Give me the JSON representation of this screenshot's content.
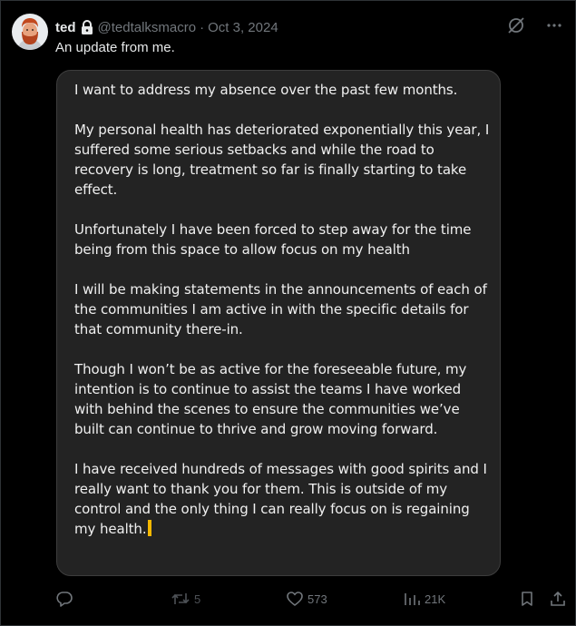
{
  "post": {
    "author_name": "ted",
    "handle": "@tedtalksmacro",
    "separator": "·",
    "date": "Oct 3, 2024",
    "text": "An update from me."
  },
  "image_text": {
    "paragraphs": [
      "I want to address my absence over the past few months.",
      "My personal health has deteriorated exponentially this year, I suffered some serious setbacks and while the road to recovery is long, treatment so far is finally starting to take effect.",
      "Unfortunately I have been forced to step away for the time being from this space to allow focus on my health",
      "I will be making statements in the announcements of each of the communities I am active in with the specific details for that community there-in.",
      "Though I won’t be as active for the foreseeable future, my intention is to continue to assist the teams I have worked with behind the scenes to ensure the communities we’ve built can continue to thrive and grow moving forward.",
      "I have received hundreds of messages with good spirits and I really want to thank you for them. This is outside of my control and the only thing I can really focus on is regaining my health."
    ]
  },
  "actions": {
    "retweets": "5",
    "likes": "573",
    "views": "21K"
  },
  "icons": {
    "lock": "lock-icon",
    "grok": "grok-icon",
    "more": "more-icon",
    "reply": "reply-icon",
    "retweet": "retweet-icon",
    "like": "heart-icon",
    "views": "views-icon",
    "bookmark": "bookmark-icon",
    "share": "share-icon"
  },
  "colors": {
    "background": "#000000",
    "text": "#e7e9ea",
    "muted": "#71767b",
    "card": "#232323",
    "caret": "#f5b800"
  }
}
